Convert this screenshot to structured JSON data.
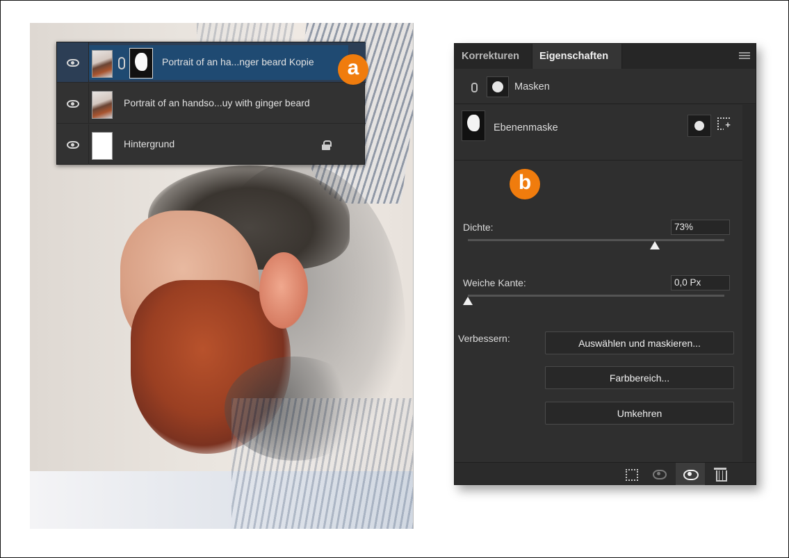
{
  "layers_panel": {
    "layers": [
      {
        "name": "Portrait of an ha...nger beard Kopie",
        "selected": true,
        "has_mask": true
      },
      {
        "name": "Portrait of an handso...uy with ginger beard",
        "selected": false,
        "has_mask": false
      },
      {
        "name": "Hintergrund",
        "selected": false,
        "locked": true
      }
    ]
  },
  "badges": {
    "a": "a",
    "b": "b",
    "color": "#f07c0d"
  },
  "properties_panel": {
    "tabs": [
      {
        "label": "Korrekturen",
        "active": false
      },
      {
        "label": "Eigenschaften",
        "active": true
      }
    ],
    "masks_label": "Masken",
    "layer_mask_label": "Ebenenmaske",
    "density": {
      "label": "Dichte:",
      "value": "73%",
      "percent": 73
    },
    "feather": {
      "label": "Weiche Kante:",
      "value": "0,0 Px",
      "percent": 0
    },
    "refine_label": "Verbessern:",
    "buttons": {
      "select_and_mask": "Auswählen und maskieren...",
      "color_range": "Farbbereich...",
      "invert": "Umkehren"
    },
    "footer_icons": [
      "selection-from-mask-icon",
      "apply-mask-icon",
      "toggle-mask-visibility-icon",
      "delete-mask-icon"
    ]
  },
  "colors": {
    "panel_bg": "#2f2f2f",
    "selected_layer": "#1f4a72",
    "accent": "#f07c0d"
  }
}
